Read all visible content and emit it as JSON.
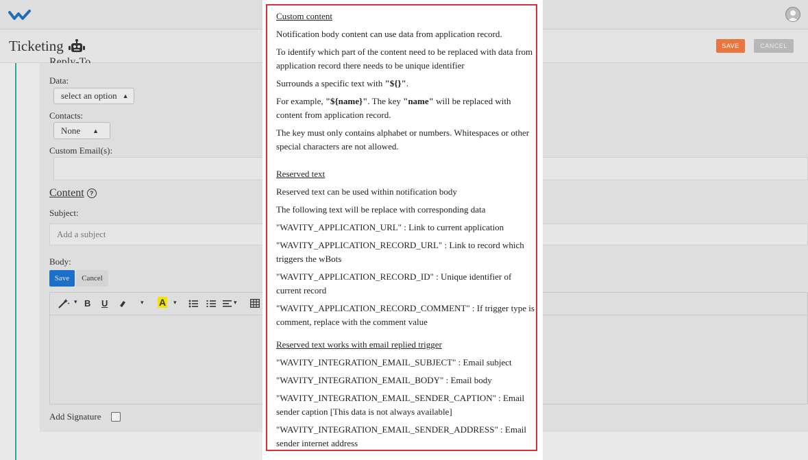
{
  "header": {
    "title": "Ticketing",
    "save_label": "SAVE",
    "cancel_label": "CANCEL"
  },
  "form": {
    "partial_heading": "Reply-To",
    "data_label": "Data:",
    "data_select_value": "select an option",
    "contacts_label": "Contacts:",
    "contacts_select_value": "None",
    "custom_email_label": "Custom Email(s):",
    "content_heading": "Content",
    "help_glyph": "?",
    "subject_label": "Subject:",
    "subject_placeholder": "Add a subject",
    "body_label": "Body:",
    "body_save": "Save",
    "body_cancel": "Cancel",
    "add_signature_label": "Add Signature",
    "toolbar": {
      "bold": "B",
      "underline": "U",
      "highlight": "A"
    }
  },
  "popover": {
    "custom_content_heading": "Custom content",
    "cc1": "Notification body content can use data from application record.",
    "cc2a": "To identify which part of the content need to be replaced with data from",
    "cc2b": "application record there needs to be unique identifier",
    "cc3_pre": "Surrounds a specific text with ",
    "cc3_bold": "\"${}\"",
    "cc3_post": ".",
    "cc4_pre": "For example, ",
    "cc4_bold1": "\"${name}\"",
    "cc4_mid": ". The key ",
    "cc4_bold2": "\"name\"",
    "cc4_post": " will be replaced with",
    "cc4b": "content from application record.",
    "cc5a": "The key must only contains alphabet or numbers. Whitespaces or other",
    "cc5b": "special characters are not allowed.",
    "reserved_heading": "Reserved text",
    "rt1": "Reserved text can be used within notification body",
    "rt2": "The following text will be replace with corresponding data",
    "rt3": "\"WAVITY_APPLICATION_URL\" : Link to current application",
    "rt4a": "\"WAVITY_APPLICATION_RECORD_URL\" : Link to record which",
    "rt4b": "triggers the wBots",
    "rt5a": "\"WAVITY_APPLICATION_RECORD_ID\" : Unique identifier of",
    "rt5b": "current record",
    "rt6a": "\"WAVITY_APPLICATION_RECORD_COMMENT\" : If trigger type is",
    "rt6b": "comment, replace with the comment value",
    "email_heading": "Reserved text works with email replied trigger",
    "em1": "\"WAVITY_INTEGRATION_EMAIL_SUBJECT\" : Email subject",
    "em2": "\"WAVITY_INTEGRATION_EMAIL_BODY\" : Email body",
    "em3a": "\"WAVITY_INTEGRATION_EMAIL_SENDER_CAPTION\" : Email",
    "em3b": "sender caption [This data is not always available]",
    "em4a": "\"WAVITY_INTEGRATION_EMAIL_SENDER_ADDRESS\" : Email",
    "em4b": "sender internet address"
  },
  "colors": {
    "accent": "#2aa6a1",
    "save_orange": "#e9753f",
    "popover_border": "#dc2e36",
    "primary_blue": "#1e6fc7"
  }
}
